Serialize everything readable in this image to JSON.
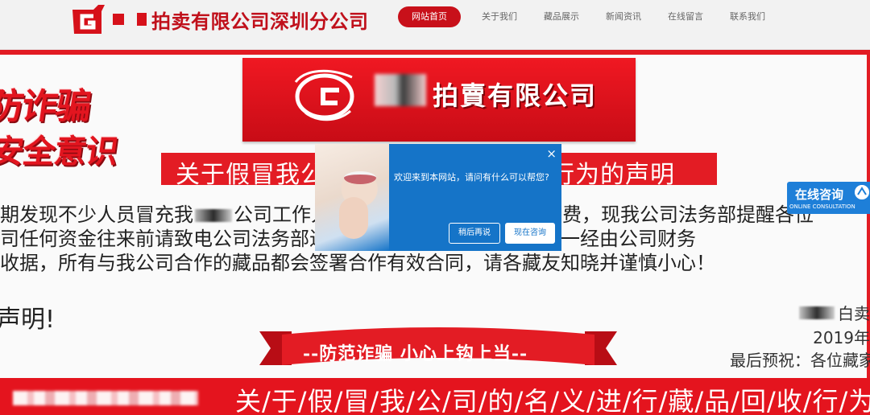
{
  "colors": {
    "brand_red": "#e31c24",
    "nav_active": "#c8101a",
    "chat_blue": "#1574c8"
  },
  "header": {
    "logo_icon": "auction-g-logo",
    "brand_name": "拍卖有限公司深圳分公司",
    "nav": [
      {
        "label": "网站首页",
        "active": true
      },
      {
        "label": "关于我们",
        "active": false
      },
      {
        "label": "藏品展示",
        "active": false
      },
      {
        "label": "新闻资讯",
        "active": false
      },
      {
        "label": "在线留言",
        "active": false
      },
      {
        "label": "联系我们",
        "active": false
      }
    ]
  },
  "content": {
    "fraud_graphic": {
      "line1": "防诈骗",
      "line2": "安全意识"
    },
    "banner": {
      "company_name": "拍賣有限公司"
    },
    "title": "关于假冒我公司工作人员私自收费行为的声明",
    "paragraph": {
      "line1_a": "期发现不少人员冒充我",
      "line1_b": "公司工作人员以我公司名义进行私自收费，现我公司法务部提醒各位",
      "line2": "司任何资金往来前请致电公司法务部进行核实，核实无误后必须统一经由公司财务",
      "line3": "收据，所有与我公司合作的藏品都会签署合作有效合同，请各藏友知晓并谨慎小心！"
    },
    "statement_heading": "声明!",
    "signature": {
      "company_suffix": "白卖",
      "date": "2019年",
      "wish": "最后预祝：各位藏家藏"
    },
    "ribbon_slogan": "--防范诈骗 小心上钩上当--",
    "bottom_marquee": "关/于/假/冒/我/公/司/的/名/义/进/行/藏/品/回/收/行/为"
  },
  "chat_popup": {
    "message": "欢迎来到本网站，请问有什么可以帮您?",
    "close_symbol": "×",
    "later_button": "稍后再说",
    "consult_button": "现在咨询"
  },
  "side_consult": {
    "label_cn": "在线咨询",
    "label_en": "ONLINE CONSULTATION"
  }
}
